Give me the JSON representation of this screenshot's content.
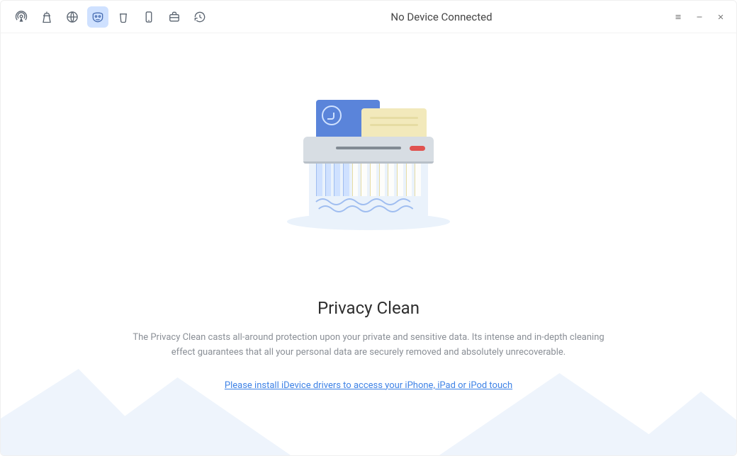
{
  "titlebar": {
    "status_text": "No Device Connected"
  },
  "nav": {
    "items": [
      {
        "name": "airdrop-icon",
        "active": false
      },
      {
        "name": "speedup-icon",
        "active": false
      },
      {
        "name": "globe-icon",
        "active": false
      },
      {
        "name": "privacy-mask-icon",
        "active": true
      },
      {
        "name": "trash-icon",
        "active": false
      },
      {
        "name": "phone-icon",
        "active": false
      },
      {
        "name": "briefcase-icon",
        "active": false
      },
      {
        "name": "history-icon",
        "active": false
      }
    ]
  },
  "main": {
    "heading": "Privacy Clean",
    "description": "The Privacy Clean casts all-around protection upon your private and sensitive data. Its intense and in-depth cleaning effect guarantees that all your personal data are securely removed and absolutely unrecoverable.",
    "install_link_text": "Please install iDevice drivers to access your iPhone, iPad or iPod touch"
  }
}
